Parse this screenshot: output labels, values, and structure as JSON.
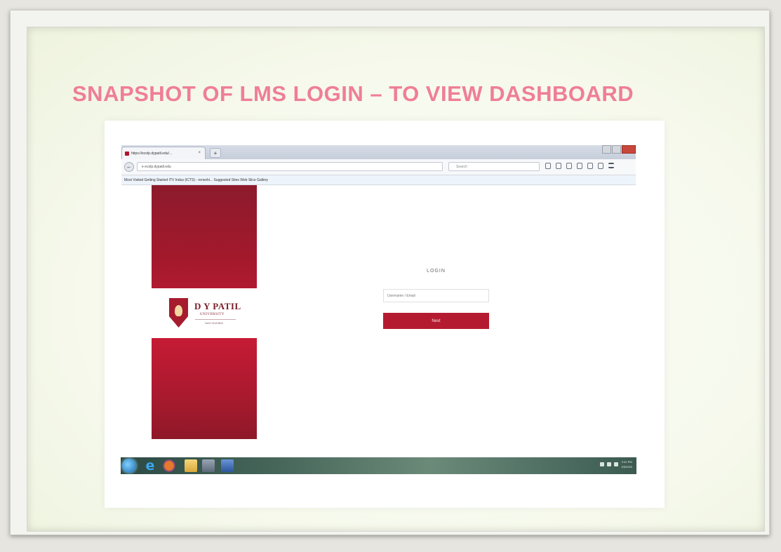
{
  "slide": {
    "title": "SNAPSHOT OF LMS LOGIN – TO VIEW DASHBOARD",
    "title_color": "#ef7e96"
  },
  "browser": {
    "tab_title": "https://ecolp.dypatil.edu/...",
    "tab_close": "×",
    "new_tab": "+",
    "back_glyph": "←",
    "url": "e ecolp.dypatil.edu",
    "search_placeholder": "Search",
    "bookmarks": "Most Visited  Getting Started  ITV Indus (ICTS) - reneshi...  Suggested Sites  Web Slice Gallery"
  },
  "page": {
    "university_name": "D Y PATIL",
    "university_sub": "UNIVERSITY",
    "university_loc": "NAVI MUMBAI",
    "login_heading": "LOGIN",
    "username_placeholder": "Username / Email",
    "login_button": "Next",
    "brand_color": "#b51b30"
  },
  "taskbar": {
    "ie_glyph": "e",
    "clock_time": "2:41 PM",
    "clock_date": "3/5/2020"
  }
}
